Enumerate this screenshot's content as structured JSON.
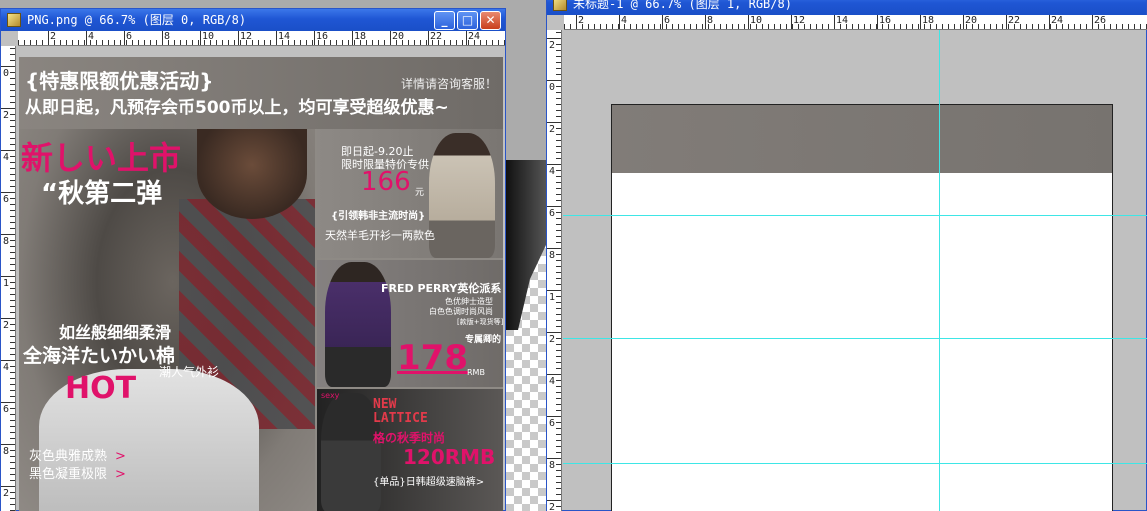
{
  "left_window": {
    "title": "PNG.png @ 66.7% (图层 0, RGB/8)",
    "controls": {
      "minimize": "_",
      "maximize": "□",
      "close": "✕"
    },
    "ruler_h_labels": [
      "2",
      "4",
      "6",
      "8",
      "10",
      "12",
      "14",
      "16",
      "18",
      "20",
      "22",
      "24"
    ],
    "ruler_v_labels": [
      "0",
      "2",
      "4",
      "6",
      "8",
      "1",
      "2",
      "4",
      "6",
      "8",
      "2"
    ],
    "banner": {
      "title": "{特惠限额优惠活动}",
      "subtitle": "从即日起，凡预存会币500币以上，均可享受超级优惠~",
      "contact": "详情请咨询客服！"
    },
    "main": {
      "jp_title": "新しい上市",
      "quote": "“秋第二弹",
      "silk": "如丝般细细柔滑",
      "cotton": "全海洋たいかい棉",
      "tide": "潮人气外衫",
      "hot": "HOT",
      "color1": "灰色典雅成熟",
      "color2": "黑色凝重极限",
      "arrow": ">"
    },
    "panel1": {
      "line1": "即日起-9.20止",
      "line2": "限时限量特价专供",
      "price": "166",
      "unit": "元",
      "tag": "{引领韩非主流时尚}",
      "desc": "天然羊毛开衫一两款色"
    },
    "panel2": {
      "brand": "FRED PERRY英伦派系",
      "line1": "色优绅士造型",
      "line2": "白色色调时尚风尚",
      "line3": "[款版+现货等]",
      "exclusive": "专属卿的",
      "price": "178",
      "unit": "RMB"
    },
    "panel3": {
      "tag": "sexy",
      "new1": "NEW",
      "new2": "LATTICE",
      "sub": "格の秋季时尚",
      "price": "120RMB",
      "desc": "{单品}日韩超级速脑裤>"
    }
  },
  "right_window": {
    "title": "未标题-1 @ 66.7% (图层 1, RGB/8)",
    "ruler_h_labels": [
      "2",
      "4",
      "6",
      "8",
      "10",
      "12",
      "14",
      "16",
      "18",
      "20",
      "22",
      "24",
      "26"
    ],
    "ruler_v_labels": [
      "2",
      "0",
      "2",
      "4",
      "6",
      "8",
      "1",
      "2",
      "4",
      "6",
      "8",
      "2"
    ]
  }
}
